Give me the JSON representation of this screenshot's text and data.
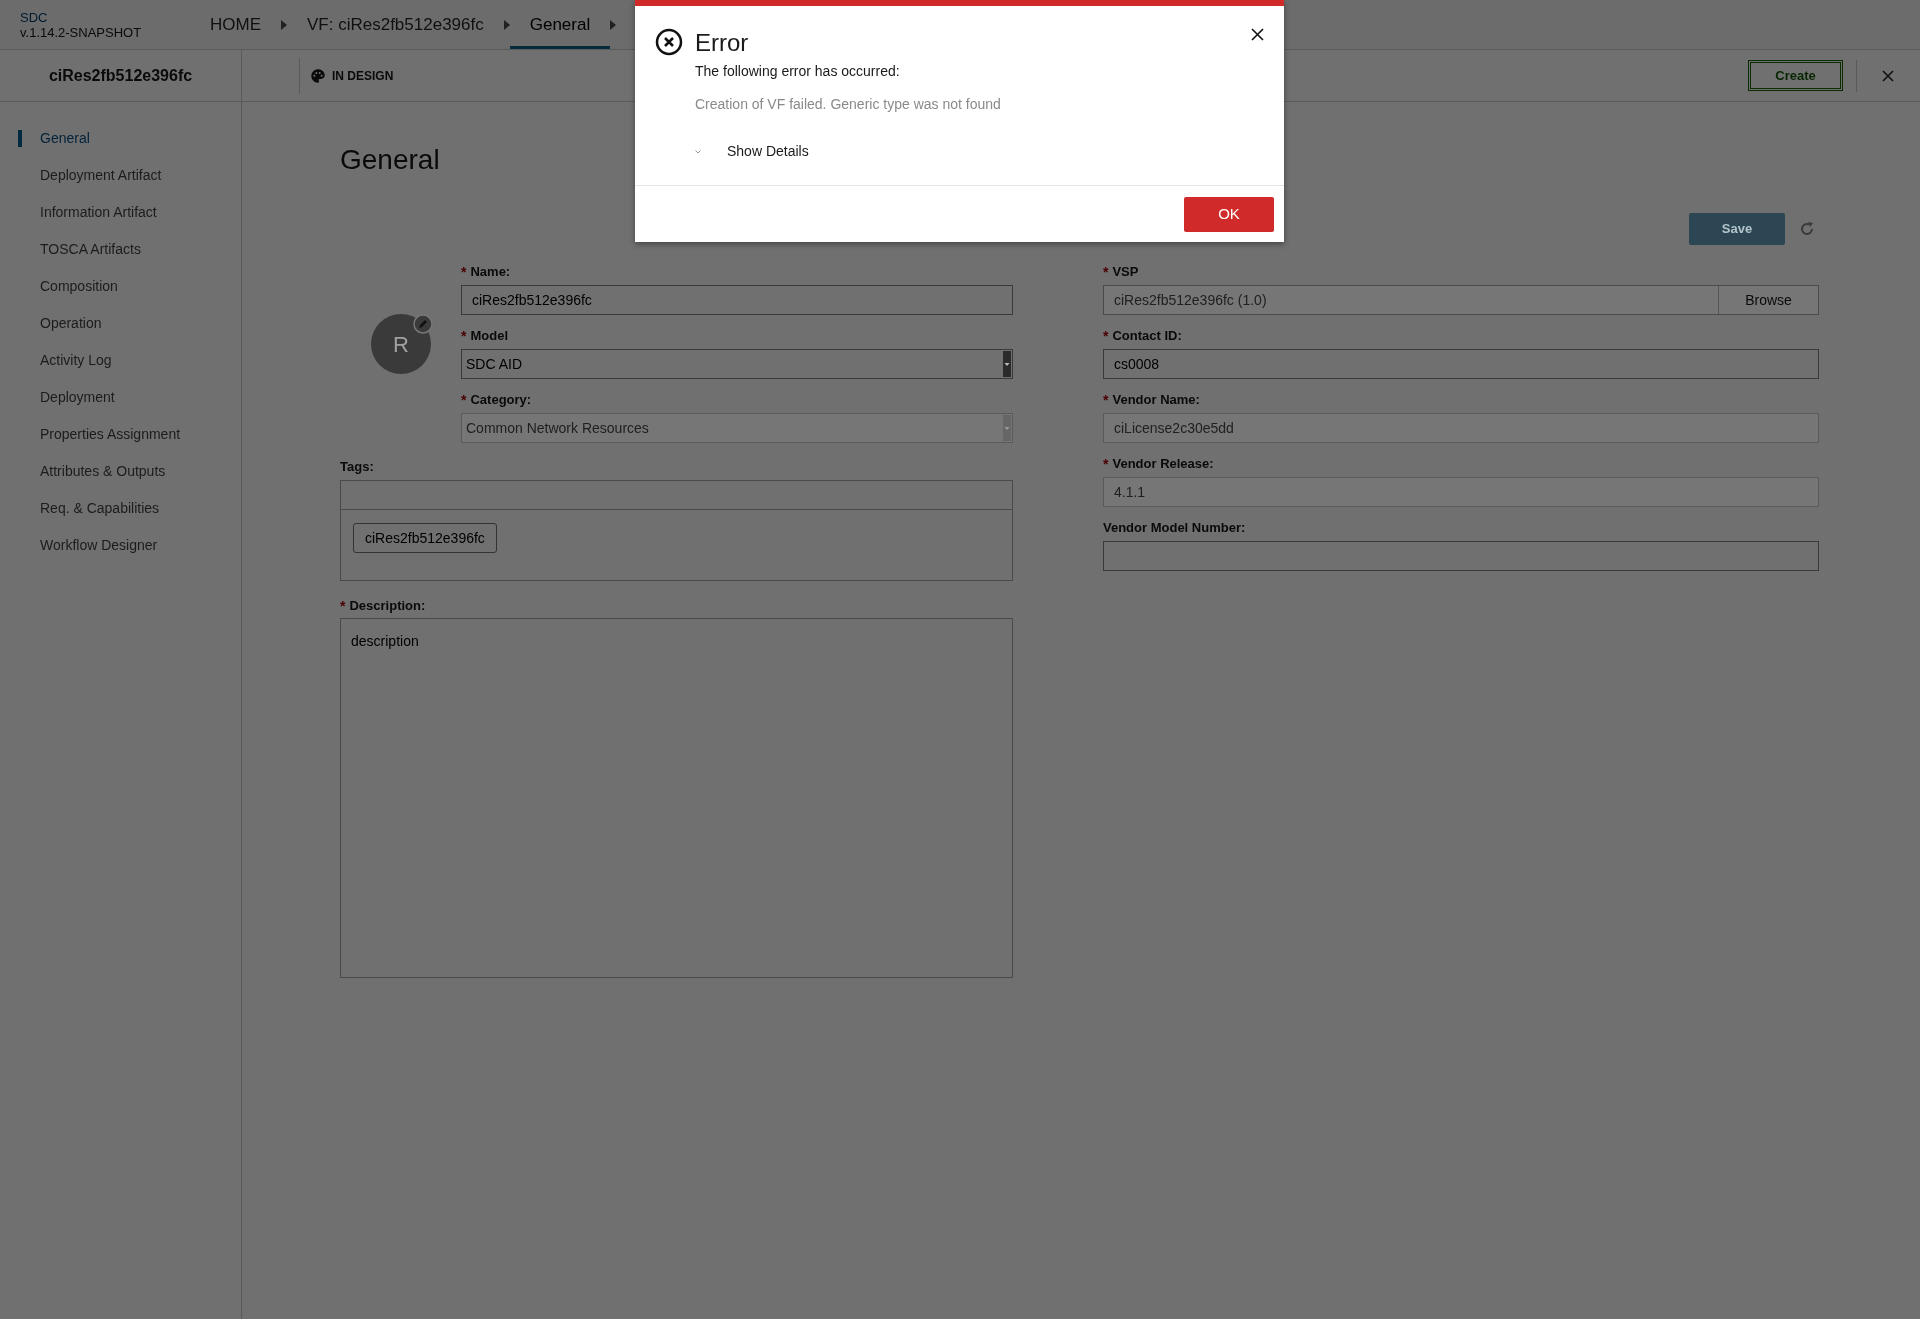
{
  "header": {
    "app_name": "SDC",
    "version": "v.1.14.2-SNAPSHOT",
    "breadcrumbs": [
      {
        "label": "HOME",
        "selected": false
      },
      {
        "label": "VF: ciRes2fb512e396fc",
        "selected": false
      },
      {
        "label": "General",
        "selected": true
      }
    ]
  },
  "subheader": {
    "title": "ciRes2fb512e396fc",
    "status": "IN DESIGN",
    "create_button": "Create"
  },
  "sidebar": {
    "items": [
      {
        "label": "General",
        "selected": true
      },
      {
        "label": "Deployment Artifact",
        "selected": false
      },
      {
        "label": "Information Artifact",
        "selected": false
      },
      {
        "label": "TOSCA Artifacts",
        "selected": false
      },
      {
        "label": "Composition",
        "selected": false
      },
      {
        "label": "Operation",
        "selected": false
      },
      {
        "label": "Activity Log",
        "selected": false
      },
      {
        "label": "Deployment",
        "selected": false
      },
      {
        "label": "Properties Assignment",
        "selected": false
      },
      {
        "label": "Attributes & Outputs",
        "selected": false
      },
      {
        "label": "Req. & Capabilities",
        "selected": false
      },
      {
        "label": "Workflow Designer",
        "selected": false
      }
    ]
  },
  "required_mark": "*",
  "page_title": "General",
  "save_button": "Save",
  "avatar_letter": "R",
  "left_fields": [
    {
      "label": "Name:",
      "value": "ciRes2fb512e396fc",
      "required": true,
      "disabled": false,
      "kind": "text"
    },
    {
      "label": "Model",
      "value": "SDC AID",
      "required": true,
      "disabled": false,
      "kind": "select"
    },
    {
      "label": "Category:",
      "value": "Common Network Resources",
      "required": true,
      "disabled": true,
      "kind": "select"
    }
  ],
  "tags": {
    "label": "Tags:",
    "items": [
      "ciRes2fb512e396fc"
    ]
  },
  "description": {
    "label": "Description:",
    "value": "description",
    "required": true
  },
  "right_fields": [
    {
      "label": "VSP",
      "value": "ciRes2fb512e396fc (1.0)",
      "required": true,
      "disabled": true,
      "kind": "browse",
      "button": "Browse"
    },
    {
      "label": "Contact ID:",
      "value": "cs0008",
      "required": true,
      "disabled": false,
      "kind": "text"
    },
    {
      "label": "Vendor Name:",
      "value": "ciLicense2c30e5dd",
      "required": true,
      "disabled": true,
      "kind": "text"
    },
    {
      "label": "Vendor Release:",
      "value": "4.1.1",
      "required": true,
      "disabled": true,
      "kind": "text"
    },
    {
      "label": "Vendor Model Number:",
      "required": false,
      "disabled": false,
      "kind": "text"
    }
  ],
  "modal": {
    "title": "Error",
    "message": "The following error has occurred:",
    "detail": "Creation of VF failed. Generic type was not found",
    "details_toggle": "Show Details",
    "details_expanded": false,
    "ok_button": "OK"
  }
}
